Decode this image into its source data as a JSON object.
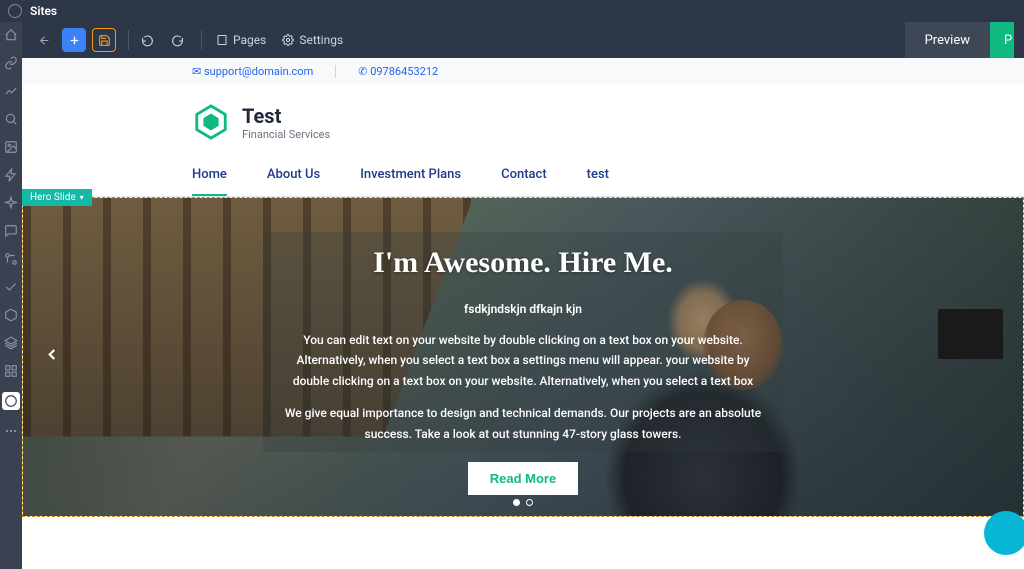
{
  "app": {
    "title": "Sites"
  },
  "toolbar": {
    "pages": "Pages",
    "settings": "Settings",
    "preview": "Preview",
    "publish": "P"
  },
  "info": {
    "email": "support@domain.com",
    "phone": "09786453212"
  },
  "brand": {
    "name": "Test",
    "tagline": "Financial Services"
  },
  "nav": {
    "items": [
      {
        "label": "Home",
        "active": true
      },
      {
        "label": "About Us"
      },
      {
        "label": "Investment Plans"
      },
      {
        "label": "Contact"
      },
      {
        "label": "test"
      }
    ]
  },
  "hero_tag": "Hero Slide",
  "hero": {
    "title": "I'm Awesome. Hire Me.",
    "subtitle": "fsdkjndskjn dfkajn kjn",
    "p1": "You can edit text on your website by double clicking on a text box on your website. Alternatively, when you select a text box a settings menu will appear. your website by double clicking on a text box on your website. Alternatively, when you select a text box",
    "p2": "We give equal importance to design and technical demands. Our projects are an absolute success. Take a look at out stunning 47-story glass towers.",
    "cta": "Read More"
  }
}
